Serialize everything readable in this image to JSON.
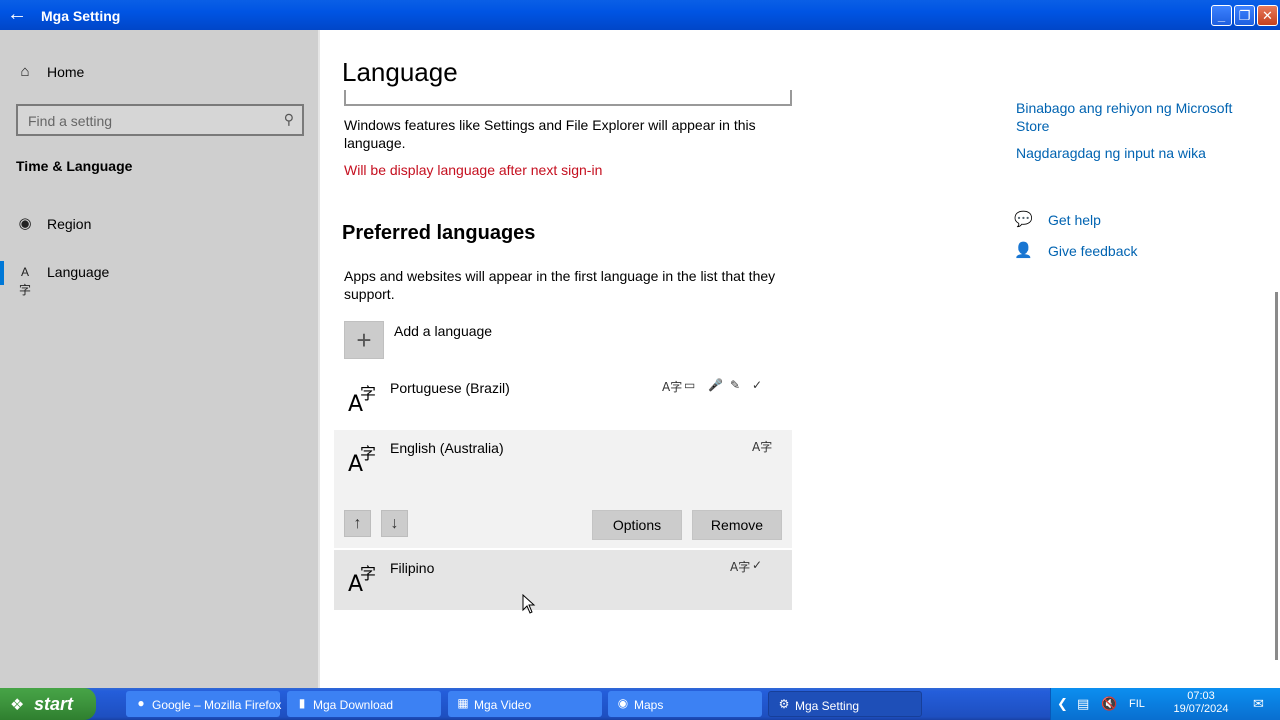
{
  "window": {
    "title": "Mga Setting"
  },
  "sidebar": {
    "home": "Home",
    "search_placeholder": "Find a setting",
    "section": "Time & Language",
    "items": [
      {
        "label": "Region",
        "icon": "region-icon"
      },
      {
        "label": "Language",
        "icon": "language-icon",
        "active": true
      }
    ]
  },
  "main": {
    "title": "Language",
    "display_desc": "Windows features like Settings and File Explorer will appear in this language.",
    "display_warning": "Will be display language after next sign-in",
    "preferred_heading": "Preferred languages",
    "preferred_desc": "Apps and websites will appear in the first language in the list that they support.",
    "add_language": "Add a language",
    "languages": [
      {
        "name": "Portuguese (Brazil)",
        "features": [
          "display-language-icon",
          "text-to-speech-icon",
          "speech-icon",
          "handwriting-icon",
          "spellcheck-icon"
        ]
      },
      {
        "name": "English (Australia)",
        "features": [
          "display-language-icon"
        ],
        "selected": true
      },
      {
        "name": "Filipino",
        "features": [
          "display-language-icon",
          "spellcheck-icon"
        ]
      }
    ],
    "options_label": "Options",
    "remove_label": "Remove"
  },
  "related": {
    "links": [
      "Binabago ang rehiyon ng Microsoft Store",
      "Nagdaragdag ng input na wika"
    ],
    "help": "Get help",
    "feedback": "Give feedback"
  },
  "taskbar": {
    "start": "start",
    "tasks": [
      {
        "label": "Google – Mozilla Firefox",
        "icon": "firefox-icon"
      },
      {
        "label": "Mga Download",
        "icon": "folder-icon"
      },
      {
        "label": "Mga Video",
        "icon": "video-folder-icon"
      },
      {
        "label": "Maps",
        "icon": "maps-icon"
      },
      {
        "label": "Mga Setting",
        "icon": "gear-icon",
        "active": true
      }
    ],
    "tray": {
      "language": "FIL",
      "time": "07:03",
      "date": "19/07/2024"
    }
  },
  "colors": {
    "accent": "#0078d7",
    "warning": "#c50f1f",
    "link": "#0063b1",
    "taskbar": "#245edb",
    "start": "#3c933c"
  }
}
